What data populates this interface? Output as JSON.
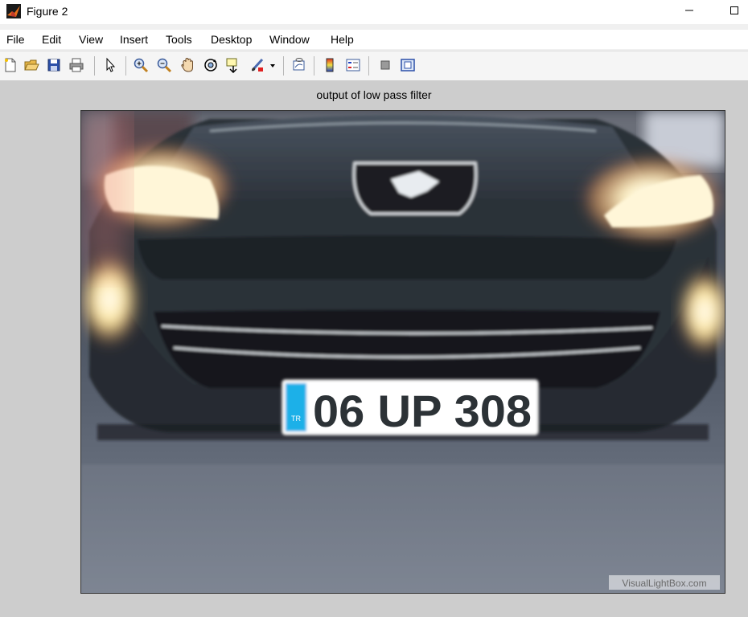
{
  "window": {
    "title": "Figure 2",
    "minimize_icon": "minimize-icon",
    "maximize_icon": "maximize-icon"
  },
  "menu": [
    "File",
    "Edit",
    "View",
    "Insert",
    "Tools",
    "Desktop",
    "Window",
    "Help"
  ],
  "toolbar": {
    "icons": [
      "new-figure-icon",
      "open-file-icon",
      "save-icon",
      "print-icon",
      "edit-plot-icon",
      "zoom-in-icon",
      "zoom-out-icon",
      "pan-icon",
      "rotate-3d-icon",
      "data-cursor-icon",
      "brush-icon",
      "brush-dropdown-icon",
      "link-plot-icon",
      "insert-colorbar-icon",
      "insert-legend-icon",
      "hide-plot-tools-icon",
      "show-plot-tools-icon"
    ]
  },
  "axes": {
    "title": "output of low pass filter",
    "image": {
      "plate_country": "TR",
      "plate_text": "06 UP 308",
      "watermark": "VisualLightBox.com"
    }
  },
  "colors": {
    "canvas_bg": "#cdcdcd",
    "plate_blue": "#1ab0e8",
    "window_bg": "#ffffff"
  }
}
